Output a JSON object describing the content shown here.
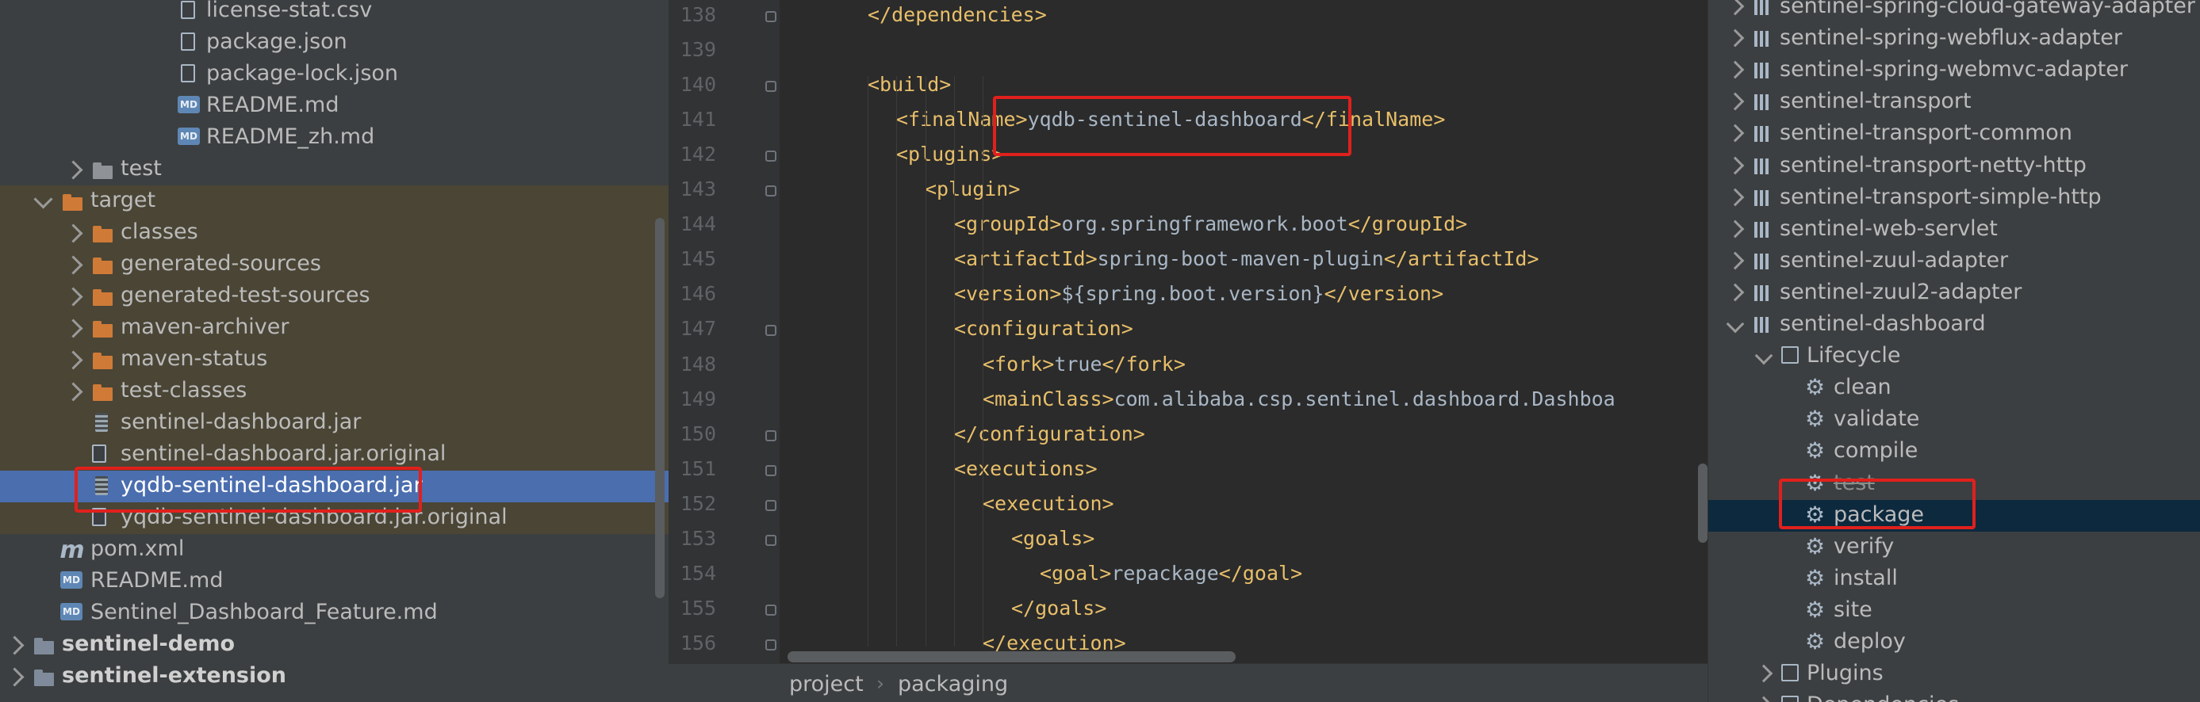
{
  "project_tree": {
    "rows": [
      {
        "label": "license-stat.csv",
        "icon": "file-csv-icon"
      },
      {
        "label": "package.json",
        "icon": "json-file-icon"
      },
      {
        "label": "package-lock.json",
        "icon": "json-file-icon"
      },
      {
        "label": "README.md",
        "icon": "markdown-file-icon"
      },
      {
        "label": "README_zh.md",
        "icon": "markdown-file-icon"
      },
      {
        "label": "test",
        "icon": "folder-icon"
      },
      {
        "label": "target",
        "icon": "excluded-folder-icon"
      },
      {
        "label": "classes",
        "icon": "excluded-folder-icon"
      },
      {
        "label": "generated-sources",
        "icon": "excluded-folder-icon"
      },
      {
        "label": "generated-test-sources",
        "icon": "excluded-folder-icon"
      },
      {
        "label": "maven-archiver",
        "icon": "excluded-folder-icon"
      },
      {
        "label": "maven-status",
        "icon": "excluded-folder-icon"
      },
      {
        "label": "test-classes",
        "icon": "excluded-folder-icon"
      },
      {
        "label": "sentinel-dashboard.jar",
        "icon": "jar-file-icon"
      },
      {
        "label": "sentinel-dashboard.jar.original",
        "icon": "unknown-file-icon"
      },
      {
        "label": "yqdb-sentinel-dashboard.jar",
        "icon": "jar-file-icon"
      },
      {
        "label": "yqdb-sentinel-dashboard.jar.original",
        "icon": "unknown-file-icon"
      },
      {
        "label": "pom.xml",
        "icon": "maven-pom-icon"
      },
      {
        "label": "README.md",
        "icon": "markdown-file-icon"
      },
      {
        "label": "Sentinel_Dashboard_Feature.md",
        "icon": "markdown-file-icon"
      },
      {
        "label": "sentinel-demo",
        "icon": "module-folder-icon"
      },
      {
        "label": "sentinel-extension",
        "icon": "module-folder-icon"
      }
    ],
    "md_icon_text": "MD",
    "pom_icon_text": "m"
  },
  "editor": {
    "line_numbers": [
      "138",
      "139",
      "140",
      "141",
      "142",
      "143",
      "144",
      "145",
      "146",
      "147",
      "148",
      "149",
      "150",
      "151",
      "152",
      "153",
      "154",
      "155",
      "156"
    ],
    "lines": [
      {
        "num": "138",
        "parts": [
          {
            "t": "tag",
            "s": "</dependencies>"
          }
        ]
      },
      {
        "num": "139",
        "parts": []
      },
      {
        "num": "140",
        "parts": [
          {
            "t": "tag",
            "s": "<build>"
          }
        ]
      },
      {
        "num": "141",
        "parts": [
          {
            "t": "tag",
            "s": "<finalName>"
          },
          {
            "t": "txt",
            "s": "yqdb-sentinel-dashboard"
          },
          {
            "t": "tag",
            "s": "</finalName>"
          }
        ]
      },
      {
        "num": "142",
        "parts": [
          {
            "t": "tag",
            "s": "<plugins>"
          }
        ]
      },
      {
        "num": "143",
        "parts": [
          {
            "t": "tag",
            "s": "<plugin>"
          }
        ]
      },
      {
        "num": "144",
        "parts": [
          {
            "t": "tag",
            "s": "<groupId>"
          },
          {
            "t": "txt",
            "s": "org.springframework.boot"
          },
          {
            "t": "tag",
            "s": "</groupId>"
          }
        ]
      },
      {
        "num": "145",
        "parts": [
          {
            "t": "tag",
            "s": "<artifactId>"
          },
          {
            "t": "txt",
            "s": "spring-boot-maven-plugin"
          },
          {
            "t": "tag",
            "s": "</artifactId>"
          }
        ]
      },
      {
        "num": "146",
        "parts": [
          {
            "t": "tag",
            "s": "<version>"
          },
          {
            "t": "txt",
            "s": "${spring.boot.version}"
          },
          {
            "t": "tag",
            "s": "</version>"
          }
        ]
      },
      {
        "num": "147",
        "parts": [
          {
            "t": "tag",
            "s": "<configuration>"
          }
        ]
      },
      {
        "num": "148",
        "parts": [
          {
            "t": "tag",
            "s": "<fork>"
          },
          {
            "t": "txt",
            "s": "true"
          },
          {
            "t": "tag",
            "s": "</fork>"
          }
        ]
      },
      {
        "num": "149",
        "parts": [
          {
            "t": "tag",
            "s": "<mainClass>"
          },
          {
            "t": "txt",
            "s": "com.alibaba.csp.sentinel.dashboard.Dashboa"
          }
        ]
      },
      {
        "num": "150",
        "parts": [
          {
            "t": "tag",
            "s": "</configuration>"
          }
        ]
      },
      {
        "num": "151",
        "parts": [
          {
            "t": "tag",
            "s": "<executions>"
          }
        ]
      },
      {
        "num": "152",
        "parts": [
          {
            "t": "tag",
            "s": "<execution>"
          }
        ]
      },
      {
        "num": "153",
        "parts": [
          {
            "t": "tag",
            "s": "<goals>"
          }
        ]
      },
      {
        "num": "154",
        "parts": [
          {
            "t": "tag",
            "s": "<goal>"
          },
          {
            "t": "txt",
            "s": "repackage"
          },
          {
            "t": "tag",
            "s": "</goal>"
          }
        ]
      },
      {
        "num": "155",
        "parts": [
          {
            "t": "tag",
            "s": "</goals>"
          }
        ]
      },
      {
        "num": "156",
        "parts": [
          {
            "t": "tag",
            "s": "</execution>"
          }
        ]
      }
    ],
    "breadcrumb": [
      "project",
      "packaging"
    ],
    "breadcrumb_separator": "›",
    "colors": {
      "tag": "#e8bf6a",
      "text": "#a9b7c6",
      "highlight": "#e0201c"
    }
  },
  "maven": {
    "partial_top": "sentinel-spring-cloud-gateway-adapter",
    "modules": [
      "sentinel-spring-webflux-adapter",
      "sentinel-spring-webmvc-adapter",
      "sentinel-transport",
      "sentinel-transport-common",
      "sentinel-transport-netty-http",
      "sentinel-transport-simple-http",
      "sentinel-web-servlet",
      "sentinel-zuul-adapter",
      "sentinel-zuul2-adapter"
    ],
    "expanded_module": "sentinel-dashboard",
    "lifecycle_label": "Lifecycle",
    "lifecycle_goals": [
      "clean",
      "validate",
      "compile",
      "test",
      "package",
      "verify",
      "install",
      "site",
      "deploy"
    ],
    "skipped_goal": "test",
    "selected_goal": "package",
    "plugins_label": "Plugins",
    "dependencies_label": "Dependencies",
    "gear_glyph": "⚙"
  }
}
